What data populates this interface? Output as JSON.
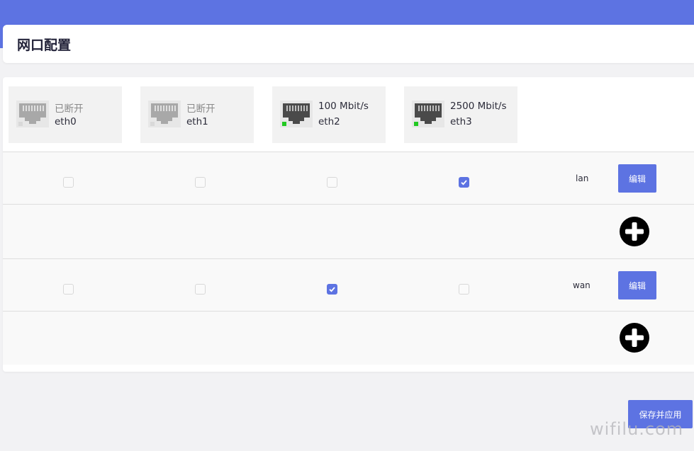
{
  "header": {
    "title": "网口配置"
  },
  "ports": [
    {
      "name": "eth0",
      "status": "已断开",
      "connected": false
    },
    {
      "name": "eth1",
      "status": "已断开",
      "connected": false
    },
    {
      "name": "eth2",
      "status": "100 Mbit/s",
      "connected": true
    },
    {
      "name": "eth3",
      "status": "2500 Mbit/s",
      "connected": true
    }
  ],
  "interfaces": [
    {
      "name": "lan",
      "members": [
        false,
        false,
        false,
        true
      ],
      "edit_label": "编辑"
    },
    {
      "name": "wan",
      "members": [
        false,
        false,
        true,
        false
      ],
      "edit_label": "编辑"
    }
  ],
  "actions": {
    "save_label": "保存并应用"
  },
  "watermark": "wifilu.com",
  "colors": {
    "accent": "#5d73e2",
    "link_up": "#22c922",
    "link_down": "#d9d9d9",
    "port_on": "#4a4a4a",
    "port_off": "#a8a8a8"
  }
}
